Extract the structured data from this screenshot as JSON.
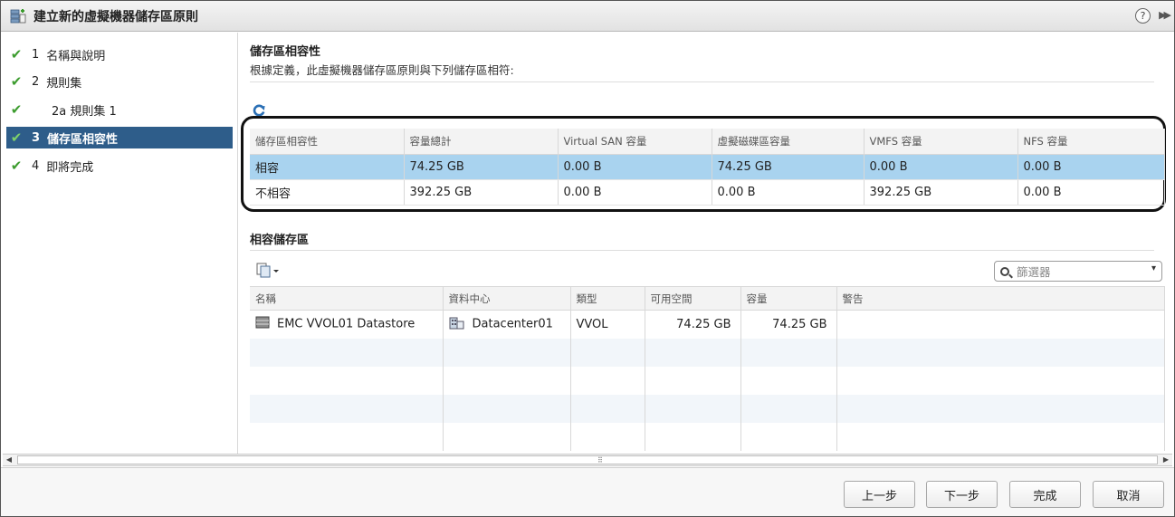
{
  "window": {
    "title": "建立新的虛擬機器儲存區原則",
    "help_label": "?",
    "collapse_label": "▶▶"
  },
  "nav": {
    "items": [
      {
        "num": "1",
        "label": "名稱與說明",
        "check": "✔"
      },
      {
        "num": "2",
        "label": "規則集",
        "check": "✔"
      },
      {
        "num": "",
        "label": "2a 規則集 1",
        "check": "✔"
      },
      {
        "num": "3",
        "label": "儲存區相容性",
        "check": "✔"
      },
      {
        "num": "4",
        "label": "即將完成",
        "check": "✔"
      }
    ],
    "active_index": 3
  },
  "compat": {
    "title": "儲存區相容性",
    "description": "根據定義，此虛擬機器儲存區原則與下列儲存區相符:",
    "columns": [
      "儲存區相容性",
      "容量總計",
      "Virtual SAN 容量",
      "虛擬磁碟區容量",
      "VMFS 容量",
      "NFS 容量"
    ],
    "rows": [
      [
        "相容",
        "74.25 GB",
        "0.00 B",
        "74.25 GB",
        "0.00 B",
        "0.00 B"
      ],
      [
        "不相容",
        "392.25 GB",
        "0.00 B",
        "0.00 B",
        "392.25 GB",
        "0.00 B"
      ]
    ],
    "selected_row": 0
  },
  "datastores": {
    "title": "相容儲存區",
    "filter_placeholder": "篩選器",
    "columns": [
      "名稱",
      "資料中心",
      "類型",
      "可用空間",
      "容量",
      "警告"
    ],
    "rows": [
      [
        "EMC VVOL01 Datastore",
        "Datacenter01",
        "VVOL",
        "74.25 GB",
        "74.25 GB",
        ""
      ]
    ]
  },
  "footer": {
    "back_label": "上一步",
    "next_label": "下一步",
    "finish_label": "完成",
    "cancel_label": "取消"
  },
  "colors": {
    "selection": "#a9d3ef",
    "nav_active": "#2e5d8a",
    "check": "#3c9c2e",
    "refresh": "#2a6fb5"
  }
}
